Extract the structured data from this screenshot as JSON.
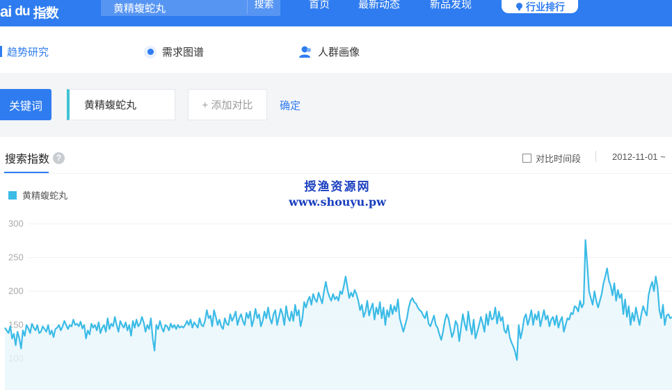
{
  "header": {
    "logo_text": "ai",
    "logo_du": "du",
    "logo_cn": "指数",
    "search_value": "黄精蝮蛇丸",
    "search_button": "搜索",
    "nav": [
      "首页",
      "最新动态",
      "新品发现"
    ],
    "rank_button": "行业排行",
    "brand_color": "#2f7cf0"
  },
  "tabs": {
    "trend": "趋势研究",
    "demand": "需求图谱",
    "crowd": "人群画像"
  },
  "keyword_bar": {
    "label": "关键词",
    "keyword": "黄精蝮蛇丸",
    "add_compare": "+ 添加对比",
    "confirm": "确定"
  },
  "chart_panel": {
    "title": "搜索指数",
    "help_icon": "?",
    "compare_period": "对比时间段",
    "date_range": "2012-11-01 ~"
  },
  "watermark": {
    "cn": "授渔资源网",
    "url": "www.shouyu.pw"
  },
  "chart_data": {
    "type": "area",
    "series": [
      {
        "name": "黄精蝮蛇丸",
        "color": "#3bbbe6",
        "values": [
          146,
          142,
          138,
          148,
          130,
          137,
          120,
          140,
          130,
          115,
          142,
          134,
          150,
          145,
          138,
          152,
          146,
          142,
          150,
          138,
          140,
          148,
          144,
          140,
          150,
          136,
          142,
          132,
          144,
          146,
          150,
          142,
          148,
          156,
          150,
          144,
          150,
          148,
          158,
          150,
          152,
          148,
          155,
          145,
          150,
          130,
          142,
          136,
          152,
          146,
          150,
          142,
          154,
          138,
          146,
          150,
          140,
          160,
          144,
          152,
          148,
          162,
          150,
          140,
          156,
          150,
          146,
          154,
          142,
          150,
          134,
          156,
          146,
          158,
          148,
          152,
          162,
          154,
          140,
          150,
          144,
          160,
          130,
          112,
          150,
          144,
          156,
          146,
          140,
          150,
          148,
          142,
          152,
          146,
          150,
          144,
          150,
          146,
          148,
          146,
          150,
          156,
          150,
          158,
          146,
          154,
          150,
          146,
          160,
          150,
          148,
          156,
          172,
          160,
          164,
          148,
          172,
          162,
          150,
          158,
          148,
          144,
          160,
          152,
          150,
          166,
          156,
          162,
          170,
          150,
          160,
          166,
          156,
          150,
          168,
          160,
          170,
          148,
          158,
          174,
          160,
          166,
          148,
          156,
          170,
          160,
          176,
          160,
          152,
          166,
          172,
          150,
          162,
          174,
          166,
          150,
          178,
          162,
          156,
          170,
          156,
          180,
          164,
          172,
          148,
          160,
          184,
          176,
          186,
          192,
          180,
          196,
          188,
          184,
          198,
          190,
          182,
          200,
          214,
          200,
          192,
          186,
          196,
          188,
          192,
          186,
          200,
          196,
          208,
          222,
          206,
          190,
          198,
          192,
          202,
          196,
          186,
          172,
          180,
          162,
          170,
          186,
          164,
          174,
          182,
          158,
          176,
          166,
          184,
          160,
          176,
          150,
          172,
          162,
          180,
          166,
          178,
          170,
          188,
          160,
          150,
          140,
          150,
          160,
          176,
          186,
          190,
          184,
          182,
          176,
          172,
          170,
          164,
          160,
          170,
          152,
          148,
          156,
          164,
          150,
          146,
          136,
          128,
          140,
          156,
          166,
          160,
          146,
          132,
          140,
          156,
          150,
          126,
          146,
          166,
          152,
          142,
          170,
          150,
          136,
          158,
          130,
          140,
          150,
          162,
          152,
          140,
          166,
          150,
          170,
          158,
          160,
          176,
          152,
          170,
          156,
          162,
          142,
          138,
          150,
          132,
          124,
          118,
          110,
          98,
          150,
          130,
          142,
          160,
          166,
          150,
          160,
          172,
          150,
          166,
          158,
          170,
          148,
          160,
          172,
          158,
          164,
          148,
          158,
          162,
          150,
          164,
          146,
          156,
          162,
          140,
          150,
          160,
          158,
          168,
          166,
          178,
          176,
          170,
          186,
          176,
          182,
          276,
          240,
          200,
          190,
          180,
          200,
          186,
          176,
          186,
          196,
          212,
          222,
          234,
          216,
          208,
          194,
          212,
          186,
          202,
          190,
          196,
          166,
          188,
          162,
          178,
          150,
          168,
          156,
          176,
          162,
          150,
          166,
          178,
          170,
          164,
          194,
          206,
          214,
          200,
          222,
          206,
          172,
          160,
          180,
          150,
          164,
          166,
          160,
          162
        ]
      }
    ],
    "ylim": [
      100,
      300
    ],
    "yticks": [
      100,
      150,
      200,
      250,
      300
    ],
    "grid": true,
    "legend": "top-left"
  }
}
